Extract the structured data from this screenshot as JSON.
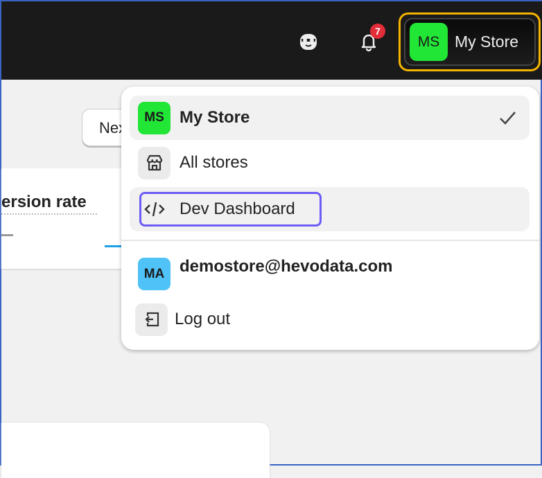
{
  "topbar": {
    "notification_count": "7",
    "store_button": {
      "initials": "MS",
      "name": "My Store",
      "avatar_color": "#22e636"
    }
  },
  "background": {
    "button_partial": "Next",
    "card_title_partial": "ersion rate"
  },
  "menu": {
    "current_store": {
      "initials": "MS",
      "name": "My Store",
      "avatar_color": "#22e636"
    },
    "all_stores": "All stores",
    "dev_dashboard": "Dev Dashboard",
    "account": {
      "initials": "MA",
      "email": "demostore@hevodata.com",
      "avatar_color": "#4fc3f7"
    },
    "logout": "Log out"
  }
}
